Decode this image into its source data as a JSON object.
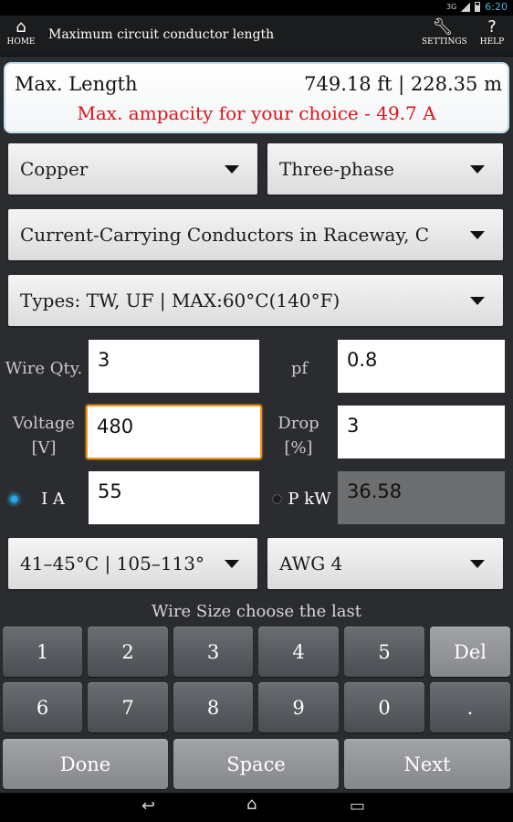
{
  "status": {
    "network": "3G",
    "time": "6:20"
  },
  "action_bar": {
    "home_label": "HOME",
    "title": "Maximum circuit conductor length",
    "settings_label": "SETTINGS",
    "help_label": "HELP",
    "help_glyph": "?"
  },
  "result": {
    "label": "Max. Length",
    "value": "749.18 ft | 228.35 m",
    "warning": "Max. ampacity for your choice - 49.7 A"
  },
  "spinners": {
    "material": "Copper",
    "phase": "Three-phase",
    "installation": "Current-Carrying Conductors in Raceway, C",
    "types": "Types: TW, UF | MAX:60°C(140°F)",
    "temperature": "41–45°C | 105–113°",
    "wire_size": "AWG 4"
  },
  "fields": {
    "wire_qty_label": "Wire Qty.",
    "wire_qty_value": "3",
    "pf_label": "pf",
    "pf_value": "0.8",
    "voltage_label_1": "Voltage",
    "voltage_label_2": "[V]",
    "voltage_value": "480",
    "drop_label_1": "Drop",
    "drop_label_2": "[%]",
    "drop_value": "3",
    "current_label": "I A",
    "current_value": "55",
    "power_label": "P kW",
    "power_value": "36.58"
  },
  "hint": "Wire Size choose the last",
  "keypad": {
    "row1": [
      "1",
      "2",
      "3",
      "4",
      "5",
      "Del"
    ],
    "row2": [
      "6",
      "7",
      "8",
      "9",
      "0",
      "."
    ],
    "row3": [
      "Done",
      "Space",
      "Next"
    ]
  },
  "colors": {
    "warning": "#e0131b",
    "focus": "#f0931e",
    "accent": "#33b5e5"
  }
}
